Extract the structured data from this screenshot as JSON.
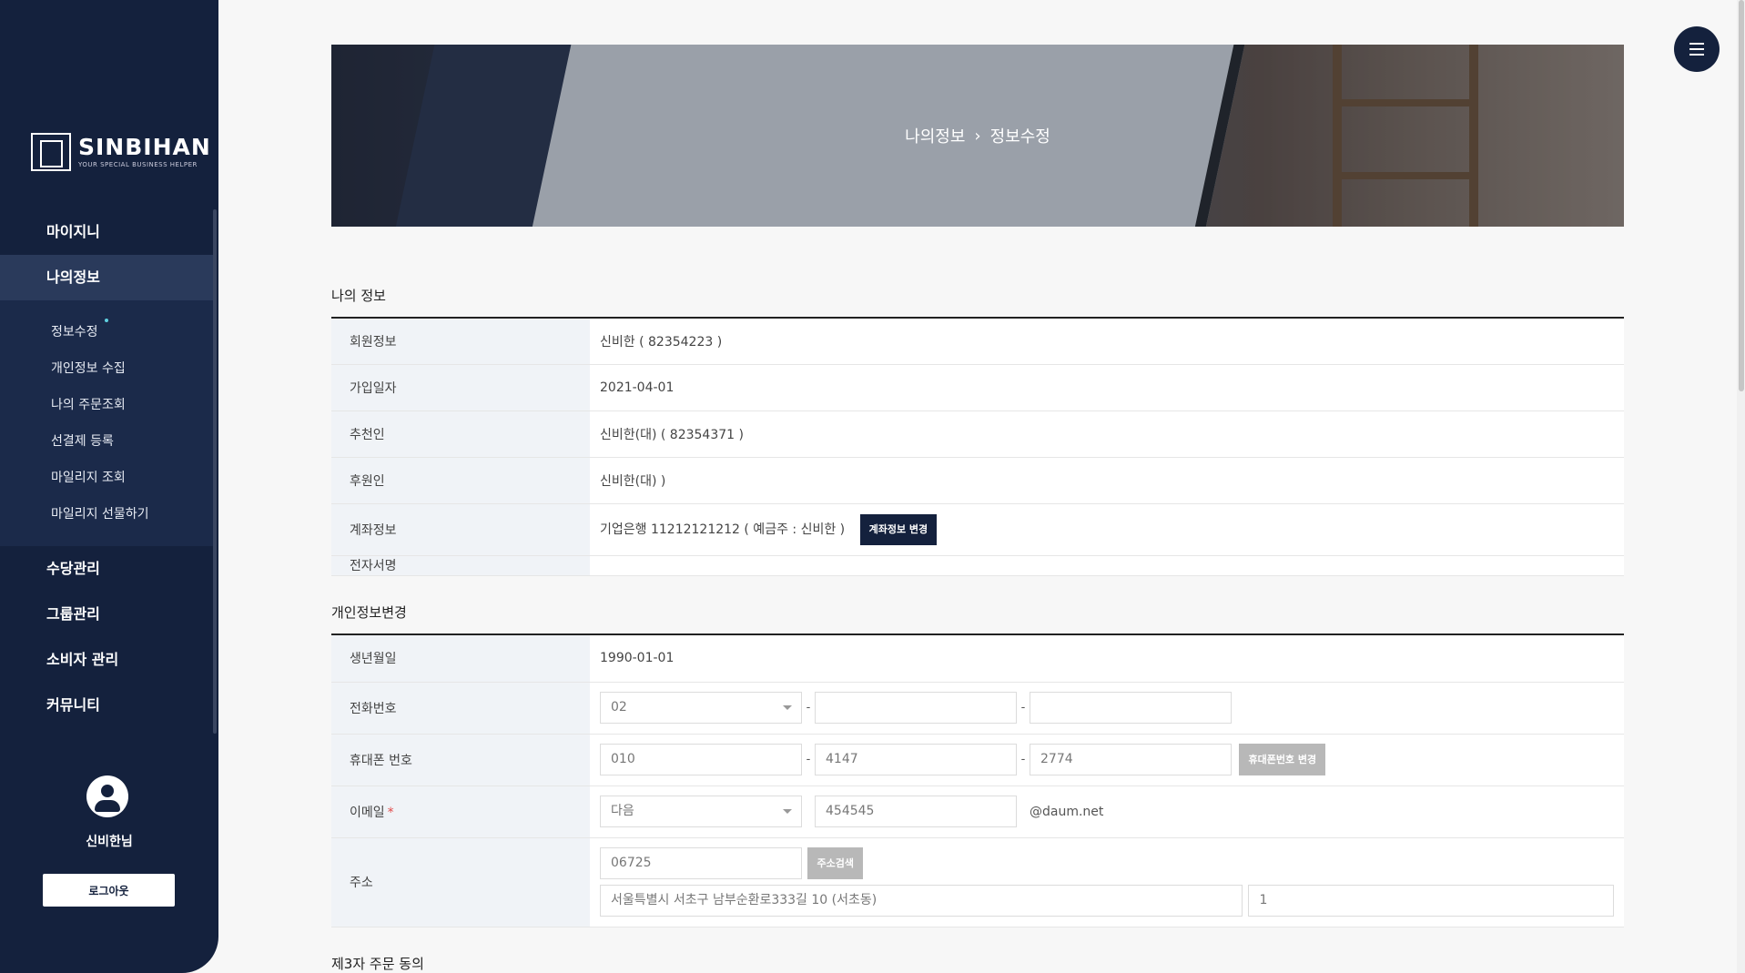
{
  "sidebar": {
    "brand": "SINBIHAN",
    "brand_tagline": "YOUR SPECIAL BUSINESS HELPER",
    "nav": [
      {
        "label": "마이지니"
      },
      {
        "label": "나의정보"
      },
      {
        "label": "수당관리"
      },
      {
        "label": "그룹관리"
      },
      {
        "label": "소비자 관리"
      },
      {
        "label": "커뮤니티"
      }
    ],
    "sub": [
      {
        "label": "정보수정"
      },
      {
        "label": "개인정보 수집"
      },
      {
        "label": "나의 주문조회"
      },
      {
        "label": "선결제 등록"
      },
      {
        "label": "마일리지 조회"
      },
      {
        "label": "마일리지 선물하기"
      }
    ],
    "username": "신비한님",
    "logout": "로그아웃"
  },
  "banner": {
    "crumb_parent": "나의정보",
    "crumb_sep": "›",
    "crumb_current": "정보수정"
  },
  "my_info": {
    "title": "나의 정보",
    "rows": [
      {
        "label": "회원정보",
        "value": "신비한 ( 82354223 )"
      },
      {
        "label": "가입일자",
        "value": "2021-04-01"
      },
      {
        "label": "추천인",
        "value": "신비한(대) ( 82354371 )"
      },
      {
        "label": "후원인",
        "value": "신비한(대) )"
      },
      {
        "label": "계좌정보",
        "value": "기업은행 11212121212 ( 예금주 : 신비한 )",
        "button": "계좌정보 변경"
      },
      {
        "label": "전자서명",
        "value": ""
      }
    ]
  },
  "personal": {
    "title": "개인정보변경",
    "birth_label": "생년월일",
    "birth_value": "1990-01-01",
    "phone_label": "전화번호",
    "phone_prefix": "02",
    "phone_mid": "",
    "phone_last": "",
    "mobile_label": "휴대폰 번호",
    "mobile_1": "010",
    "mobile_2": "4147",
    "mobile_3": "2774",
    "mobile_button": "휴대폰번호 변경",
    "email_label": "이메일",
    "email_required": "*",
    "email_provider": "다음",
    "email_id": "454545",
    "email_domain": "@daum.net",
    "address_label": "주소",
    "zip": "06725",
    "address_button": "주소검색",
    "address_main": "서울특별시 서초구 남부순환로333길 10 (서초동)",
    "address_detail": "1",
    "dash": "-"
  },
  "third_party": {
    "title": "제3자 주문 동의"
  },
  "colors": {
    "sidebar_bg": "#14213d",
    "sidebar_active": "#2a3a5b",
    "accent_dark": "#14213d",
    "required": "#e24b4b"
  }
}
